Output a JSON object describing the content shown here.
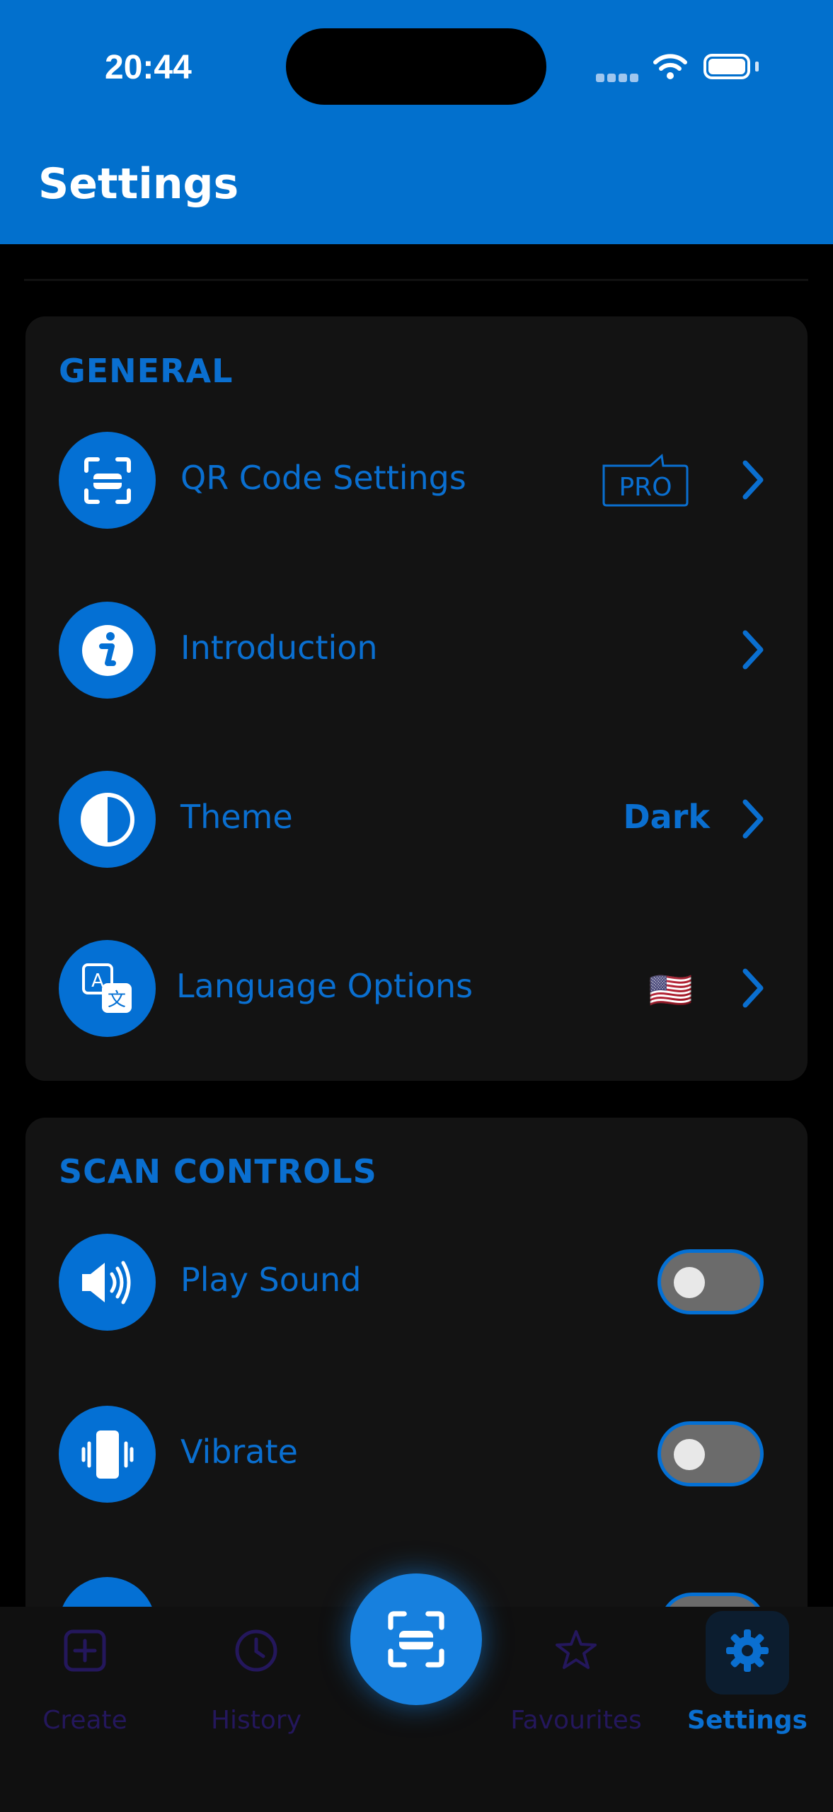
{
  "status_bar": {
    "time": "20:44"
  },
  "header": {
    "title": "Settings"
  },
  "general": {
    "title": "GENERAL",
    "items": [
      {
        "label": "QR Code Settings",
        "badge": "PRO",
        "icon": "qr-scan-icon"
      },
      {
        "label": "Introduction",
        "icon": "info-icon"
      },
      {
        "label": "Theme",
        "value": "Dark",
        "icon": "contrast-icon"
      },
      {
        "label": "Language Options",
        "value": "🇺🇸",
        "icon": "translate-icon"
      }
    ]
  },
  "scan_controls": {
    "title": "SCAN CONTROLS",
    "items": [
      {
        "label": "Play Sound",
        "enabled": false,
        "icon": "speaker-icon"
      },
      {
        "label": "Vibrate",
        "enabled": false,
        "icon": "vibrate-icon"
      }
    ]
  },
  "tabbar": {
    "tabs": [
      {
        "label": "Create",
        "icon": "plus-square-icon",
        "active": false
      },
      {
        "label": "History",
        "icon": "clock-icon",
        "active": false
      },
      {
        "label": "Favourites",
        "icon": "star-icon",
        "active": false
      },
      {
        "label": "Settings",
        "icon": "gear-icon",
        "active": true
      }
    ]
  },
  "colors": {
    "accent": "#0a6fd0",
    "header_bg": "#0270cd",
    "card_bg": "#131313",
    "tab_inactive": "#24175c"
  }
}
